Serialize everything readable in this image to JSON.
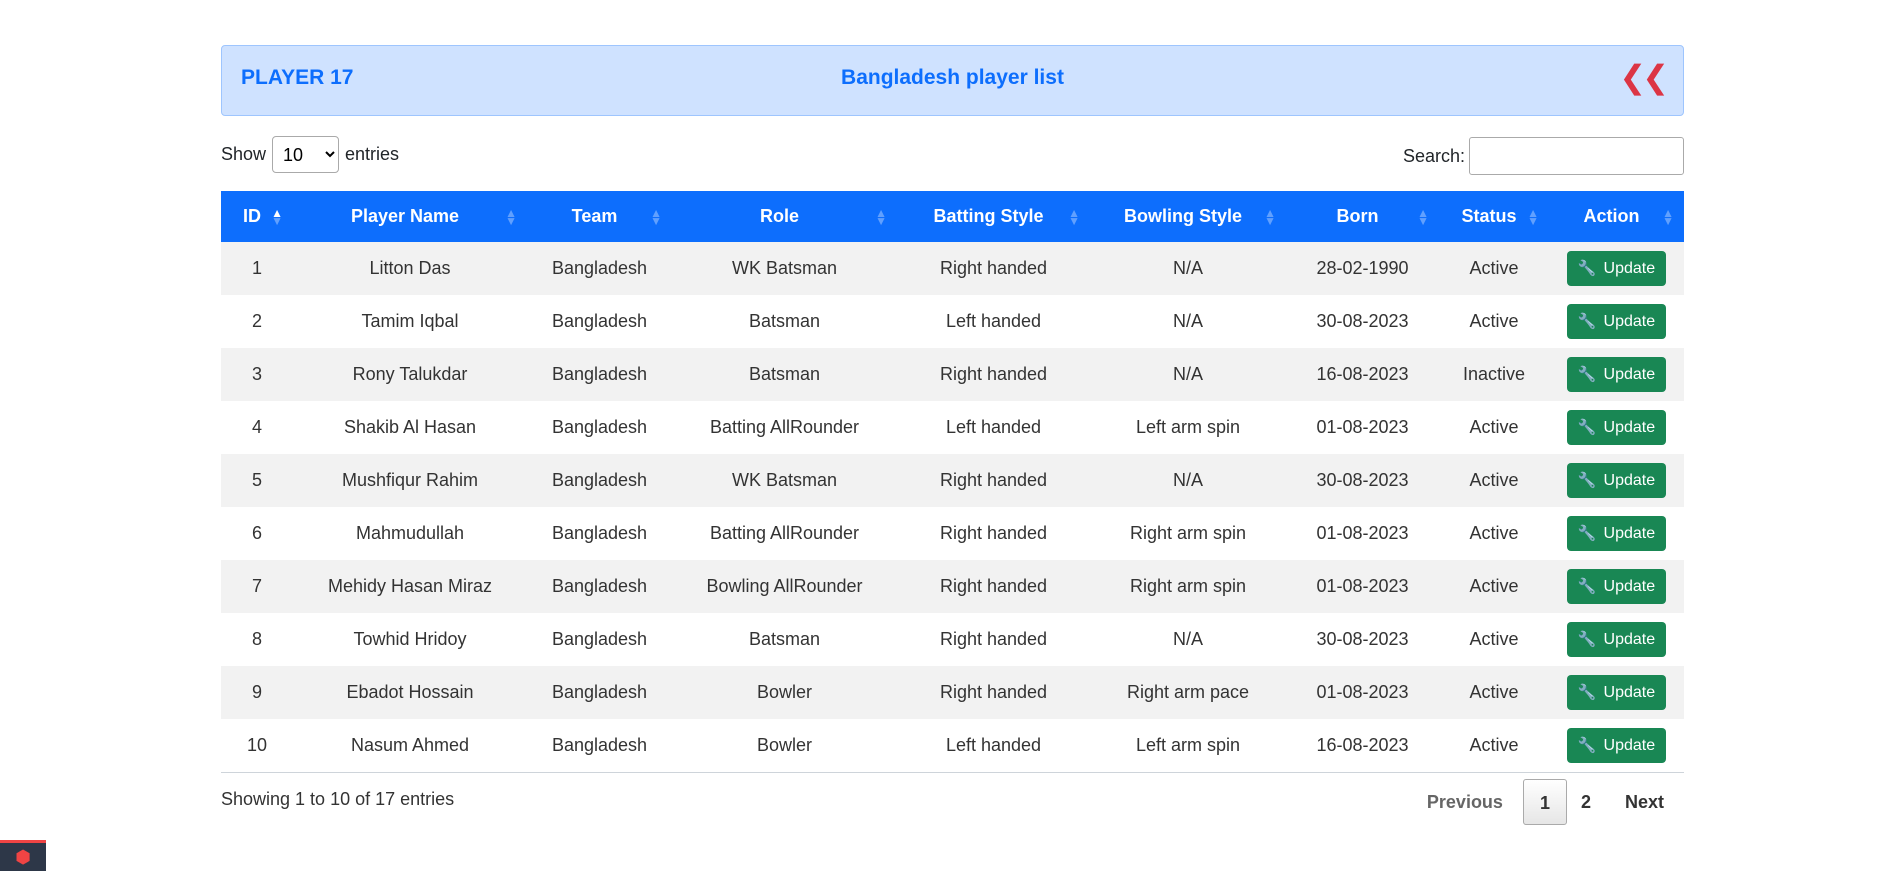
{
  "header": {
    "brand": "PLAYER 17",
    "title": "Bangladesh player list",
    "back_icon": "double-chevron-left-icon",
    "accent_color": "#0d6efd",
    "back_color": "#dc3545"
  },
  "controls": {
    "show_label": "Show",
    "entries_label": "entries",
    "page_length": "10",
    "search_label": "Search:",
    "search_value": ""
  },
  "table": {
    "columns": [
      "ID",
      "Player Name",
      "Team",
      "Role",
      "Batting Style",
      "Bowling Style",
      "Born",
      "Status",
      "Action"
    ],
    "sorted_column": "ID",
    "sort_direction": "ascending",
    "action_label": "Update",
    "action_icon": "wrench-icon",
    "rows": [
      {
        "id": "1",
        "name": "Litton Das",
        "team": "Bangladesh",
        "role": "WK Batsman",
        "batting": "Right handed",
        "bowling": "N/A",
        "born": "28-02-1990",
        "status": "Active"
      },
      {
        "id": "2",
        "name": "Tamim Iqbal",
        "team": "Bangladesh",
        "role": "Batsman",
        "batting": "Left handed",
        "bowling": "N/A",
        "born": "30-08-2023",
        "status": "Active"
      },
      {
        "id": "3",
        "name": "Rony Talukdar",
        "team": "Bangladesh",
        "role": "Batsman",
        "batting": "Right handed",
        "bowling": "N/A",
        "born": "16-08-2023",
        "status": "Inactive"
      },
      {
        "id": "4",
        "name": "Shakib Al Hasan",
        "team": "Bangladesh",
        "role": "Batting AllRounder",
        "batting": "Left handed",
        "bowling": "Left arm spin",
        "born": "01-08-2023",
        "status": "Active"
      },
      {
        "id": "5",
        "name": "Mushfiqur Rahim",
        "team": "Bangladesh",
        "role": "WK Batsman",
        "batting": "Right handed",
        "bowling": "N/A",
        "born": "30-08-2023",
        "status": "Active"
      },
      {
        "id": "6",
        "name": "Mahmudullah",
        "team": "Bangladesh",
        "role": "Batting AllRounder",
        "batting": "Right handed",
        "bowling": "Right arm spin",
        "born": "01-08-2023",
        "status": "Active"
      },
      {
        "id": "7",
        "name": "Mehidy Hasan Miraz",
        "team": "Bangladesh",
        "role": "Bowling AllRounder",
        "batting": "Right handed",
        "bowling": "Right arm spin",
        "born": "01-08-2023",
        "status": "Active"
      },
      {
        "id": "8",
        "name": "Towhid Hridoy",
        "team": "Bangladesh",
        "role": "Batsman",
        "batting": "Right handed",
        "bowling": "N/A",
        "born": "30-08-2023",
        "status": "Active"
      },
      {
        "id": "9",
        "name": "Ebadot Hossain",
        "team": "Bangladesh",
        "role": "Bowler",
        "batting": "Right handed",
        "bowling": "Right arm pace",
        "born": "01-08-2023",
        "status": "Active"
      },
      {
        "id": "10",
        "name": "Nasum Ahmed",
        "team": "Bangladesh",
        "role": "Bowler",
        "batting": "Left handed",
        "bowling": "Left arm spin",
        "born": "16-08-2023",
        "status": "Active"
      }
    ]
  },
  "footer": {
    "info": "Showing 1 to 10 of 17 entries",
    "previous": "Previous",
    "pages": [
      "1",
      "2"
    ],
    "current_page": "1",
    "next": "Next"
  },
  "colors": {
    "header_bg": "#0d6efd",
    "update_button": "#198754",
    "inactive": "#dc3545"
  },
  "corner_logo_icon": "laravel-icon"
}
